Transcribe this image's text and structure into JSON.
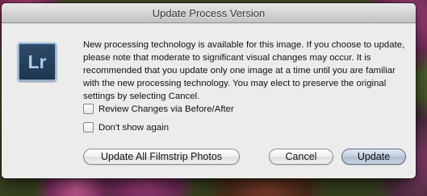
{
  "dialog": {
    "title": "Update Process Version",
    "app_icon_text": "Lr",
    "message": "New processing technology is available for this image. If you choose to update, please note that moderate to significant visual changes may occur. It is recommended that you update only one image at a time until you are familiar with the new processing technology. You may elect to preserve the original settings by selecting Cancel.",
    "checkboxes": [
      {
        "label": "Review Changes via Before/After",
        "checked": false
      },
      {
        "label": "Don't show again",
        "checked": false
      }
    ],
    "buttons": {
      "update_all": "Update All Filmstrip Photos",
      "cancel": "Cancel",
      "update": "Update"
    }
  },
  "colors": {
    "dialog_bg": "#ececec",
    "icon_bg": "#2f4a66",
    "icon_text": "#a9cdf0",
    "default_button": "#c3cfde"
  }
}
